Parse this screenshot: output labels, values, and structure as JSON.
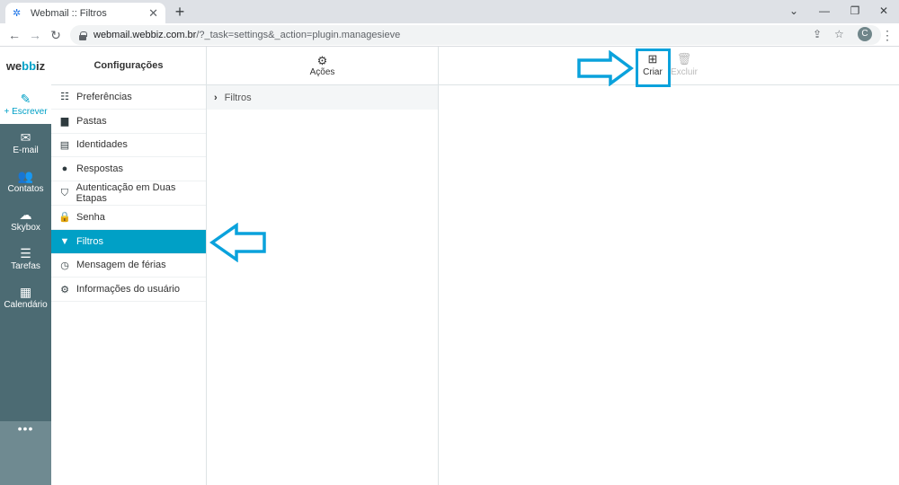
{
  "browser": {
    "tab_title": "Webmail :: Filtros",
    "new_tab": "+",
    "url_host": "webmail.webbiz.com.br",
    "url_path": "/?_task=settings&_action=plugin.managesieve",
    "avatar_letter": "C"
  },
  "app": {
    "logo_left": "we",
    "logo_mid": "bb",
    "logo_right": "iz"
  },
  "left_nav": [
    {
      "label": "+ Escrever",
      "icon": "compose-icon"
    },
    {
      "label": "E-mail",
      "icon": "mail-icon"
    },
    {
      "label": "Contatos",
      "icon": "contacts-icon"
    },
    {
      "label": "Skybox",
      "icon": "cloud-icon"
    },
    {
      "label": "Tarefas",
      "icon": "tasks-icon"
    },
    {
      "label": "Calendário",
      "icon": "calendar-icon"
    }
  ],
  "more_label": "•••",
  "settings": {
    "header": "Configurações",
    "items": [
      {
        "label": "Preferências",
        "icon": "sliders-icon"
      },
      {
        "label": "Pastas",
        "icon": "folder-icon"
      },
      {
        "label": "Identidades",
        "icon": "id-card-icon"
      },
      {
        "label": "Respostas",
        "icon": "comment-icon"
      },
      {
        "label": "Autenticação em Duas Etapas",
        "icon": "shield-icon"
      },
      {
        "label": "Senha",
        "icon": "lock-icon"
      },
      {
        "label": "Filtros",
        "icon": "filter-icon",
        "active": true
      },
      {
        "label": "Mensagem de férias",
        "icon": "clock-icon"
      },
      {
        "label": "Informações do usuário",
        "icon": "gear-icon"
      }
    ]
  },
  "filters": {
    "actions_label": "Ações",
    "set_label": "Filtros"
  },
  "toolbar": {
    "create_label": "Criar",
    "delete_label": "Excluir"
  },
  "colors": {
    "accent": "#00a0c6",
    "nav_bg": "#4c6b73",
    "annotation": "#0aa2dc"
  }
}
